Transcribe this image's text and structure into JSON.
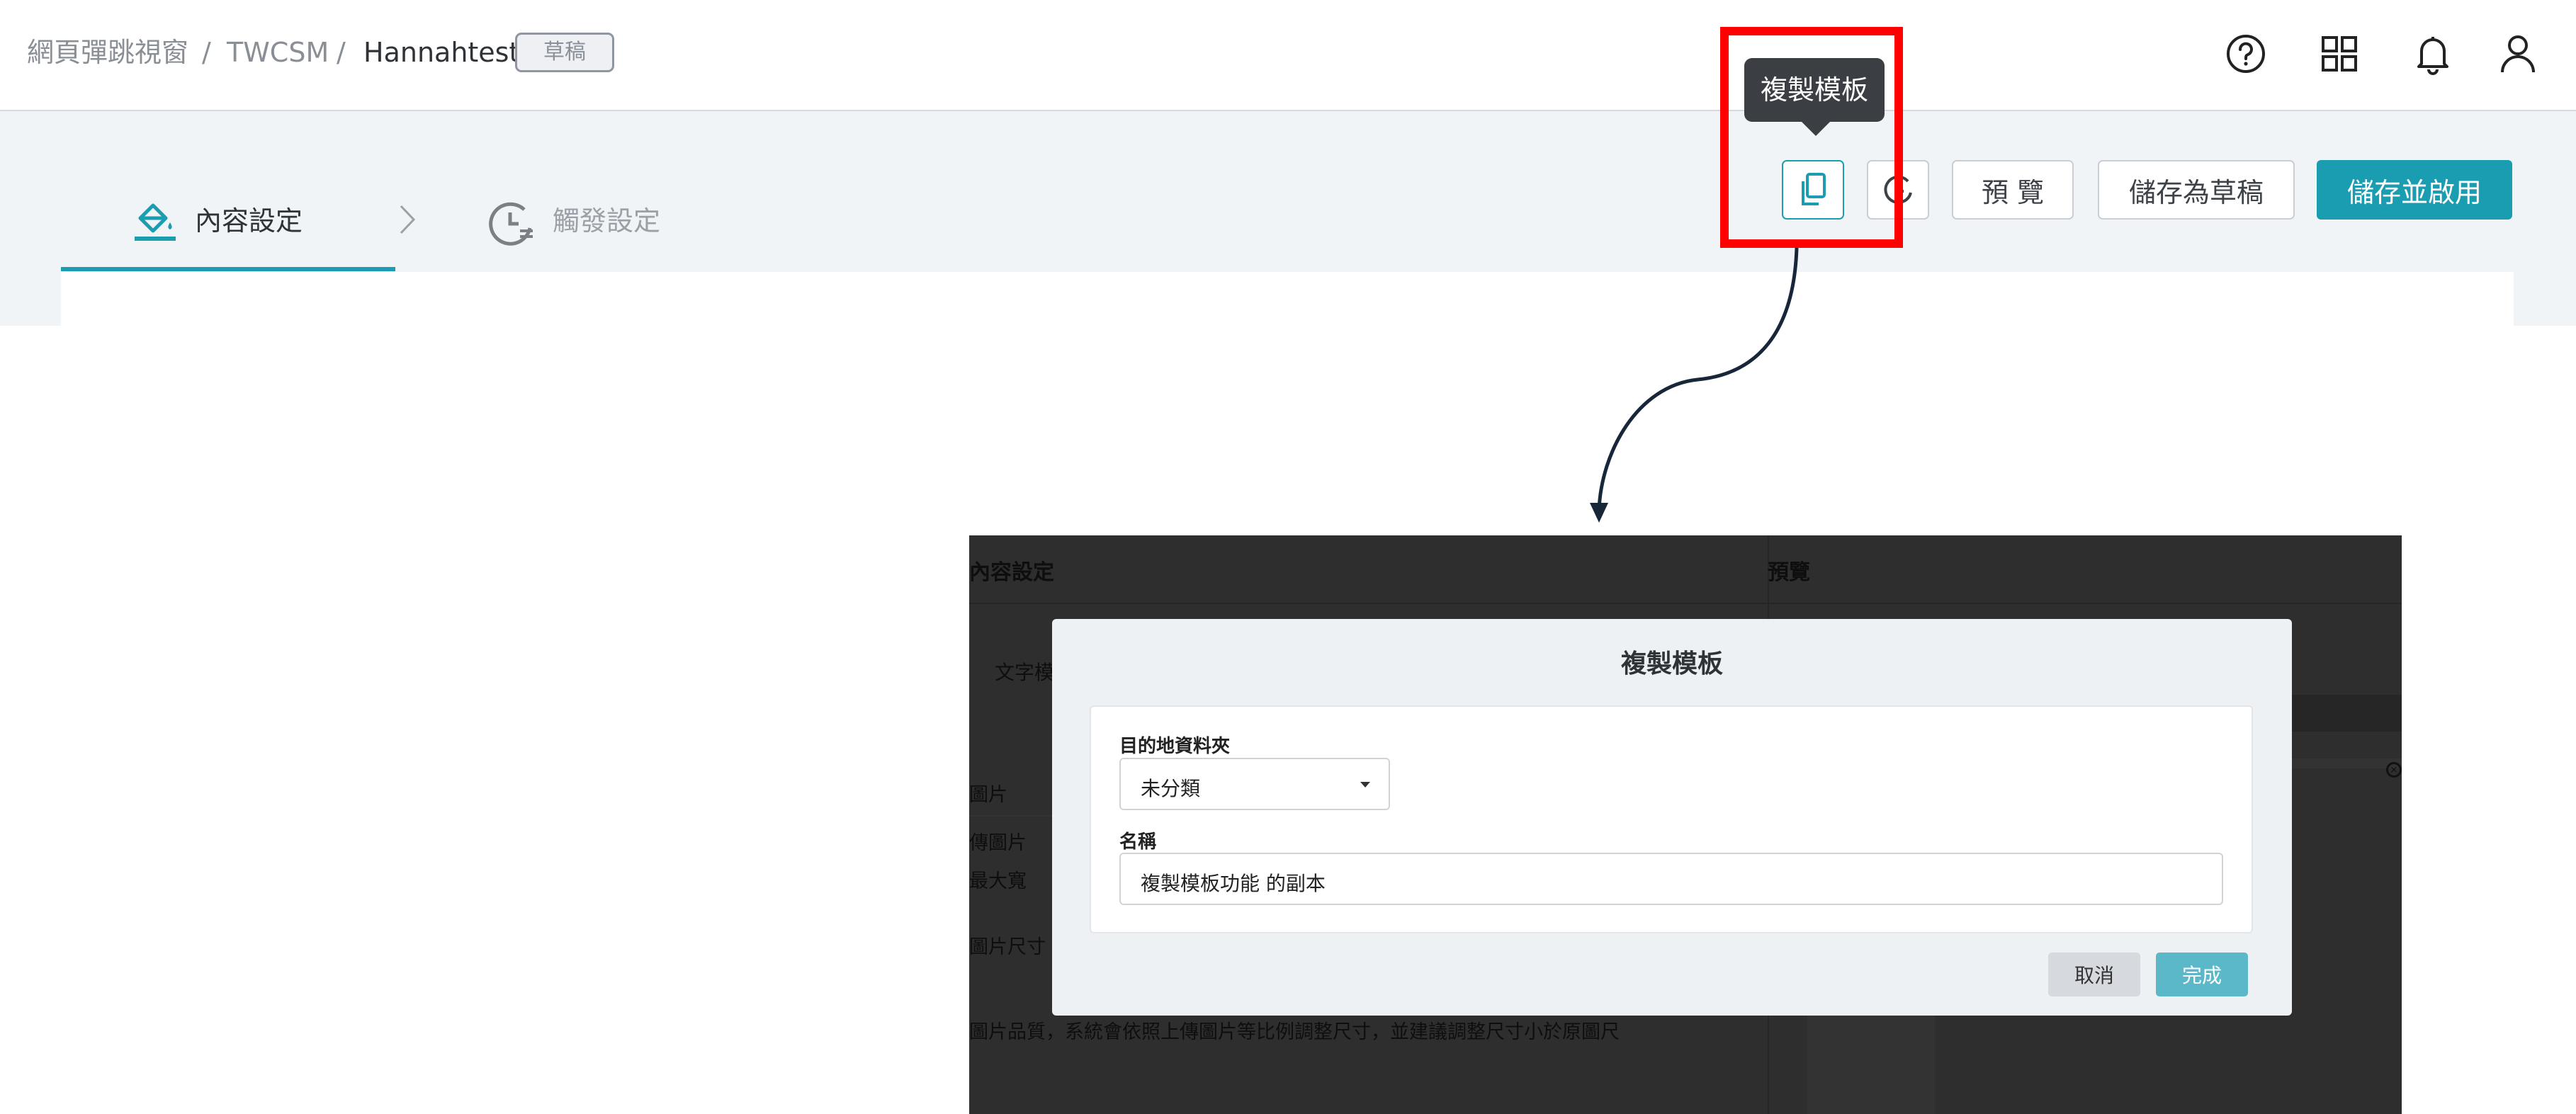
{
  "header": {
    "breadcrumb": [
      "網頁彈跳視窗",
      "TWCSM",
      "Hannahtest"
    ],
    "separator": "/",
    "status_badge": "草稿",
    "icons": [
      "help-icon",
      "apps-grid-icon",
      "bell-icon",
      "user-icon"
    ]
  },
  "steps": {
    "step1": "內容設定",
    "step2": "觸發設定"
  },
  "toolbar": {
    "tooltip": "複製模板",
    "preview": "預 覽",
    "save_draft": "儲存為草稿",
    "save_enable": "儲存並啟用"
  },
  "colors": {
    "accent": "#1b9db1",
    "highlight": "#ff0000"
  },
  "background_page": {
    "section_content": "內容設定",
    "section_preview": "預覽",
    "text_template": "文字模",
    "image": "圖片",
    "upload_image": "傳圖片",
    "max_width": "最大寬",
    "image_size": "圖片尺寸",
    "quality_note": "圖片品質，系統會依照上傳圖片等比例調整尺寸，並建議調整尺寸小於原圖尺"
  },
  "modal": {
    "title": "複製模板",
    "folder_label": "目的地資料夾",
    "folder_value": "未分類",
    "name_label": "名稱",
    "name_value": "複製模板功能 的副本",
    "cancel": "取消",
    "done": "完成"
  }
}
